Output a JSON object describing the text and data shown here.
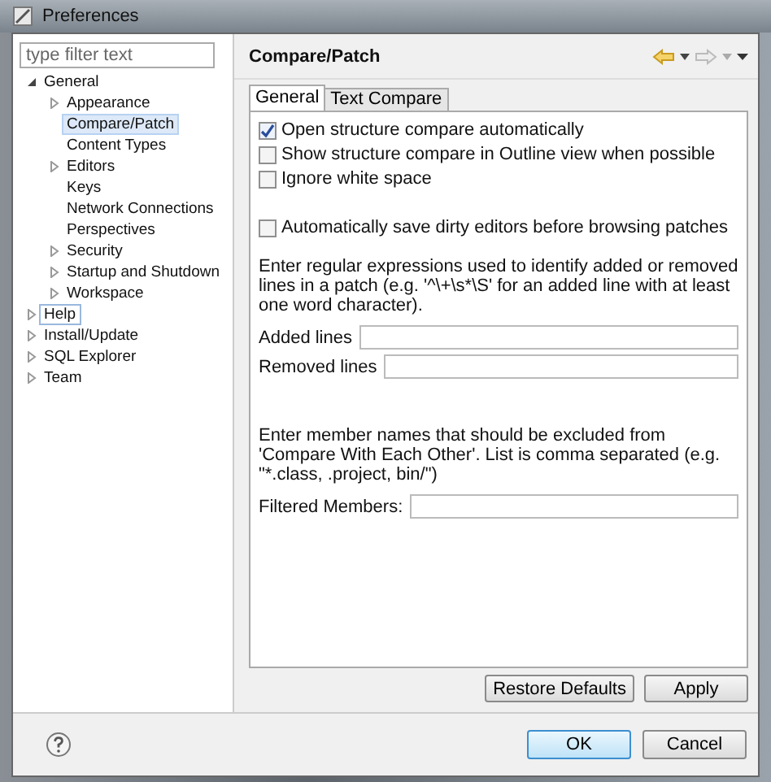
{
  "window": {
    "title": "Preferences"
  },
  "filter": {
    "placeholder": "type filter text"
  },
  "tree": [
    {
      "label": "General",
      "expanded": true,
      "selected": false,
      "focused": false,
      "children": [
        {
          "label": "Appearance",
          "expanded": false,
          "selected": false,
          "focused": false
        },
        {
          "label": "Compare/Patch",
          "selected": true,
          "focused": false
        },
        {
          "label": "Content Types",
          "selected": false,
          "focused": false
        },
        {
          "label": "Editors",
          "expanded": false,
          "selected": false,
          "focused": false
        },
        {
          "label": "Keys",
          "selected": false,
          "focused": false
        },
        {
          "label": "Network Connections",
          "selected": false,
          "focused": false
        },
        {
          "label": "Perspectives",
          "selected": false,
          "focused": false
        },
        {
          "label": "Security",
          "expanded": false,
          "selected": false,
          "focused": false
        },
        {
          "label": "Startup and Shutdown",
          "expanded": false,
          "selected": false,
          "focused": false
        },
        {
          "label": "Workspace",
          "expanded": false,
          "selected": false,
          "focused": false
        }
      ]
    },
    {
      "label": "Help",
      "expanded": false,
      "selected": false,
      "focused": true
    },
    {
      "label": "Install/Update",
      "expanded": false,
      "selected": false,
      "focused": false
    },
    {
      "label": "SQL Explorer",
      "expanded": false,
      "selected": false,
      "focused": false
    },
    {
      "label": "Team",
      "expanded": false,
      "selected": false,
      "focused": false
    }
  ],
  "page": {
    "title": "Compare/Patch"
  },
  "tabs": [
    {
      "label": "General",
      "selected": true
    },
    {
      "label": "Text Compare",
      "selected": false
    }
  ],
  "options": [
    {
      "label": "Open structure compare automatically",
      "checked": true
    },
    {
      "label": "Show structure compare in Outline view when possible",
      "checked": false
    },
    {
      "label": "Ignore white space",
      "checked": false
    }
  ],
  "autosave": {
    "label": "Automatically save dirty editors before browsing patches",
    "checked": false
  },
  "regex_hint": "Enter regular expressions used to identify added or removed lines in a patch (e.g. '^\\+\\s*\\S' for an added line with at least one word character).",
  "regex_fields": [
    {
      "label": "Added lines"
    },
    {
      "label": "Removed lines"
    }
  ],
  "member_hint": "Enter member names that should be excluded from 'Compare With Each Other'. List is comma separated (e.g. \"*.class, .project, bin/\")",
  "member_field": {
    "label": "Filtered Members:"
  },
  "page_buttons": [
    "Restore Defaults",
    "Apply"
  ],
  "dialog_buttons": [
    {
      "label": "OK",
      "default": true
    },
    {
      "label": "Cancel",
      "default": false
    }
  ]
}
